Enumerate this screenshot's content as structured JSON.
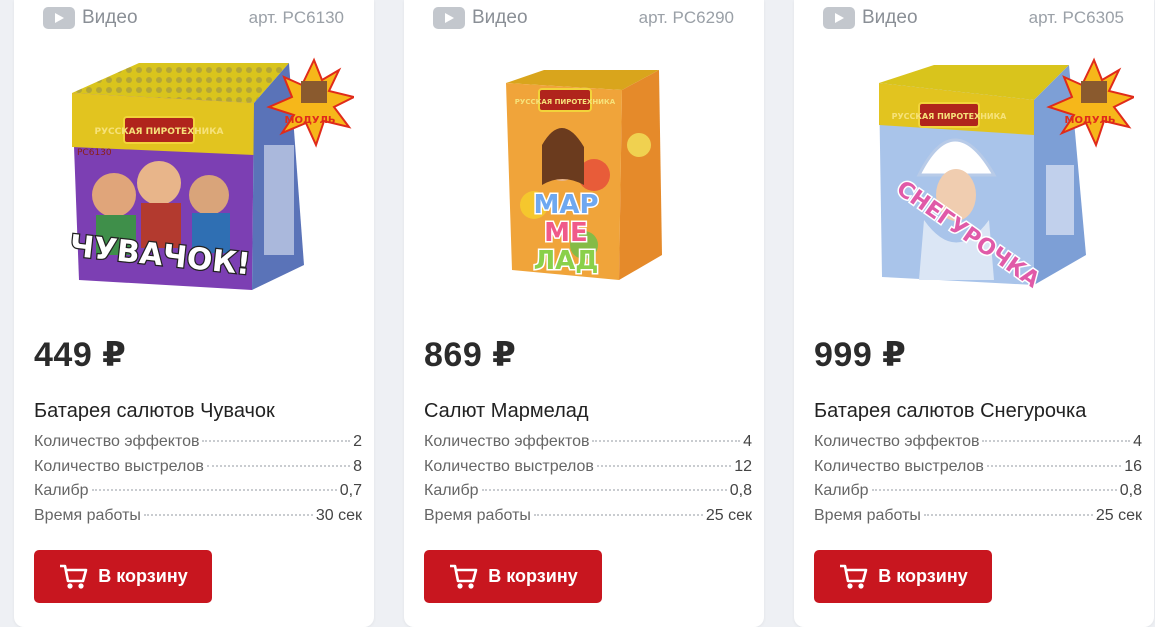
{
  "cards": [
    {
      "video_label": "Видео",
      "article": "арт. PC6130",
      "price": "449 ₽",
      "title": "Батарея салютов Чувачок",
      "specs": [
        {
          "label": "Количество эффектов",
          "value": "2"
        },
        {
          "label": "Количество выстрелов",
          "value": "8"
        },
        {
          "label": "Калибр",
          "value": "0,7"
        },
        {
          "label": "Время работы",
          "value": "30 сек"
        }
      ],
      "cart_label": "В корзину",
      "box_brand": "РУССКАЯ ПИРОТЕХНИКА",
      "box_code": "PC6130",
      "box_name": "ЧУВАЧОК!",
      "badge": "МОДУЛЬ"
    },
    {
      "video_label": "Видео",
      "article": "арт. PC6290",
      "price": "869 ₽",
      "title": "Салют Мармелад",
      "specs": [
        {
          "label": "Количество эффектов",
          "value": "4"
        },
        {
          "label": "Количество выстрелов",
          "value": "12"
        },
        {
          "label": "Калибр",
          "value": "0,8"
        },
        {
          "label": "Время работы",
          "value": "25 сек"
        }
      ],
      "cart_label": "В корзину",
      "box_brand": "РУССКАЯ ПИРОТЕХНИКА",
      "box_name_lines": [
        "МАР",
        "МЕ",
        "ЛАД"
      ]
    },
    {
      "video_label": "Видео",
      "article": "арт. PC6305",
      "price": "999 ₽",
      "title": "Батарея салютов Снегурочка",
      "specs": [
        {
          "label": "Количество эффектов",
          "value": "4"
        },
        {
          "label": "Количество выстрелов",
          "value": "16"
        },
        {
          "label": "Калибр",
          "value": "0,8"
        },
        {
          "label": "Время работы",
          "value": "25 сек"
        }
      ],
      "cart_label": "В корзину",
      "box_brand": "РУССКАЯ ПИРОТЕХНИКА",
      "box_name": "СНЕГУРОЧКА",
      "badge": "МОДУЛЬ"
    }
  ],
  "colors": {
    "accent": "#c8161f",
    "price": "#2b2b2b",
    "muted": "#8a8f96"
  }
}
